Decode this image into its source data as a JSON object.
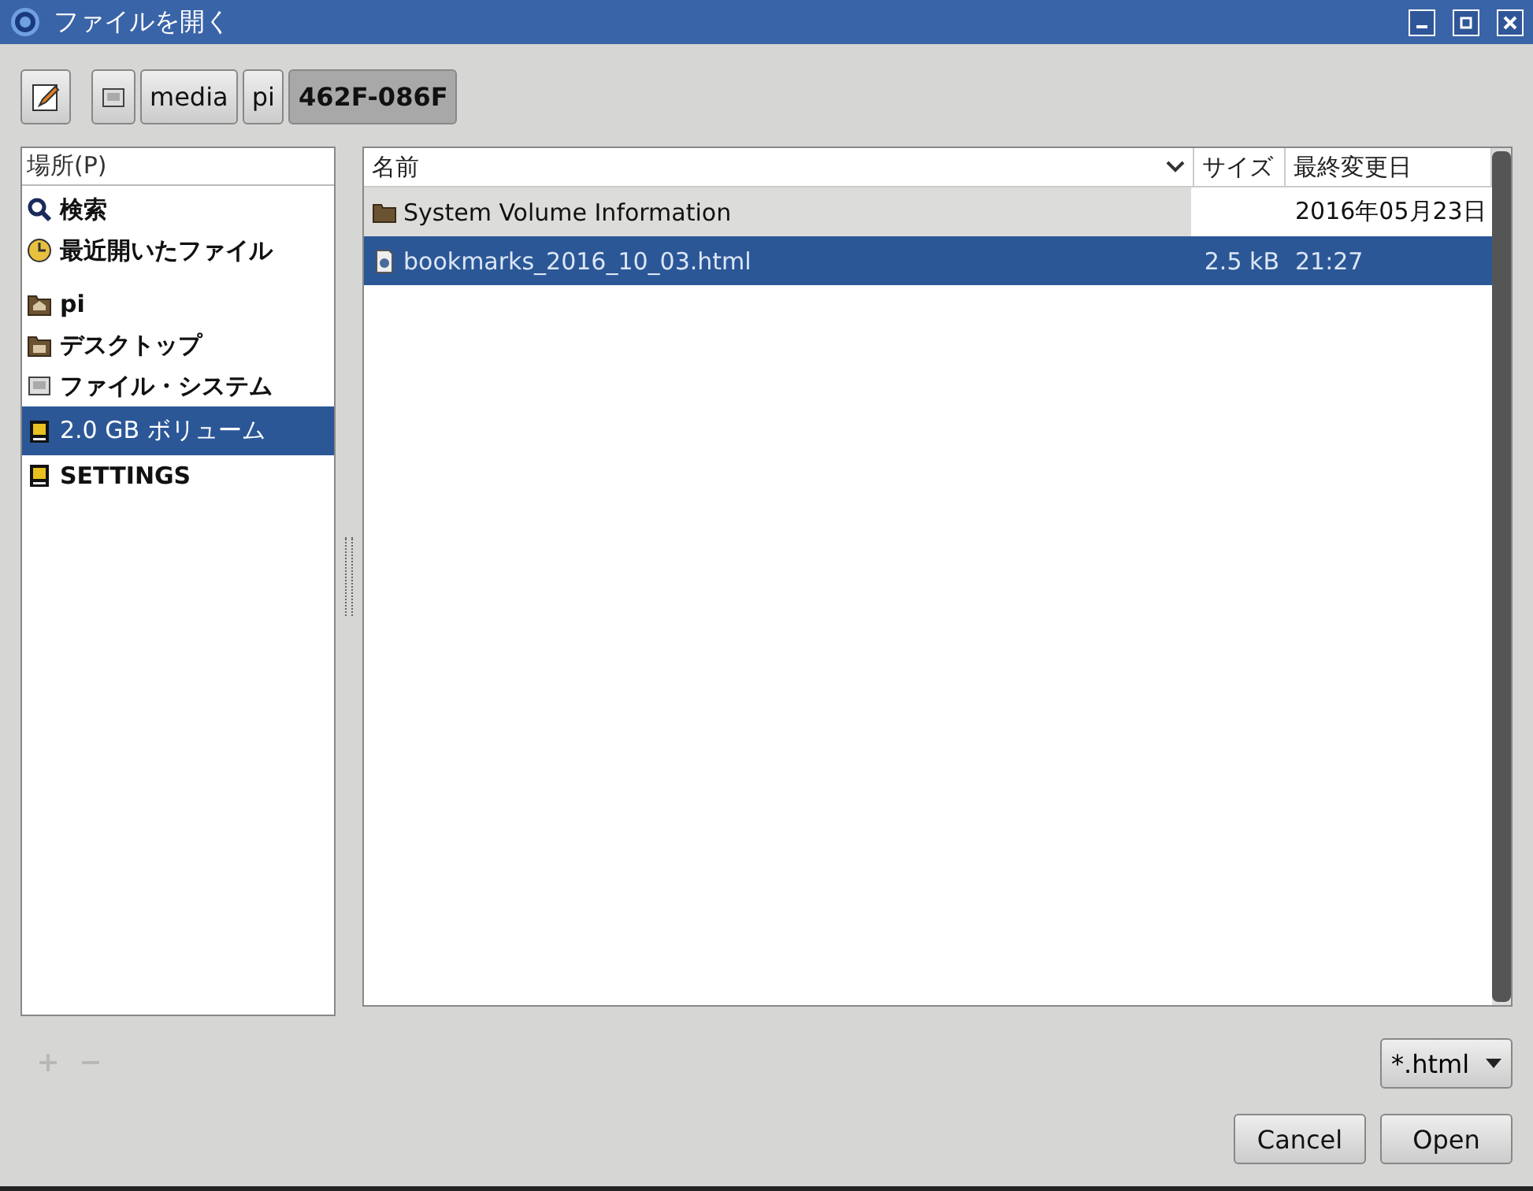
{
  "window": {
    "title": "ファイルを開く"
  },
  "path_bar": [
    {
      "label": "media",
      "selected": false
    },
    {
      "label": "pi",
      "selected": false
    },
    {
      "label": "462F-086F",
      "selected": true
    }
  ],
  "places": {
    "header": "場所(P)",
    "sections": [
      {
        "items": [
          {
            "kind": "search",
            "label": "検索",
            "selected": false
          },
          {
            "kind": "recent",
            "label": "最近開いたファイル",
            "selected": false
          }
        ]
      },
      {
        "items": [
          {
            "kind": "home",
            "label": "pi",
            "selected": false
          },
          {
            "kind": "desktop",
            "label": "デスクトップ",
            "selected": false
          },
          {
            "kind": "drive",
            "label": "ファイル・システム",
            "selected": false
          },
          {
            "kind": "usb",
            "label": "2.0 GB ボリューム",
            "selected": true
          },
          {
            "kind": "usb",
            "label": "SETTINGS",
            "selected": false
          }
        ]
      }
    ]
  },
  "files": {
    "columns": [
      "名前",
      "サイズ",
      "最終変更日"
    ],
    "rows": [
      {
        "kind": "folder",
        "name": "System Volume Information",
        "size": "",
        "modified": "2016年05月23日",
        "selected": false
      },
      {
        "kind": "file",
        "name": "bookmarks_2016_10_03.html",
        "size": "2.5 kB",
        "modified": "21:27",
        "selected": true
      }
    ]
  },
  "filter": {
    "value": "*.html"
  },
  "buttons": [
    "Cancel",
    "Open"
  ]
}
